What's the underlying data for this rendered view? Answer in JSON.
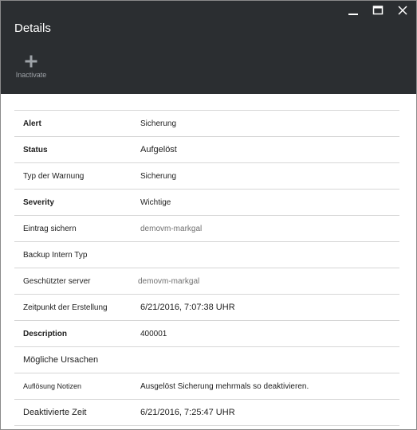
{
  "window": {
    "title": "Details"
  },
  "toolbar": {
    "inactivate_label": "Inactivate"
  },
  "details": [
    {
      "label": "Alert",
      "value": "Sicherung"
    },
    {
      "label": "Status",
      "value": "Aufgelöst"
    },
    {
      "label": "Typ der Warnung",
      "value": "Sicherung"
    },
    {
      "label": "Severity",
      "value": "Wichtige"
    },
    {
      "label": "Eintrag sichern",
      "value": "demovm-markgal"
    },
    {
      "label": "Backup Intern Typ",
      "value": ""
    },
    {
      "label": "Geschützter server",
      "value": "demovm-markgal"
    },
    {
      "label": "Zeitpunkt der Erstellung",
      "value": "6/21/2016, 7:07:38 UHR"
    },
    {
      "label": "Description",
      "value": "400001"
    },
    {
      "label": "Mögliche Ursachen",
      "value": ""
    },
    {
      "label": "Auflösung Notizen",
      "value": "Ausgelöst Sicherung mehrmals so deaktivieren."
    },
    {
      "label": "Deaktivierte Zeit",
      "value": "6/21/2016, 7:25:47 UHR"
    }
  ],
  "colors": {
    "header_bg": "#2b2e31",
    "border": "#d6d6d6",
    "link_muted": "#707070"
  }
}
